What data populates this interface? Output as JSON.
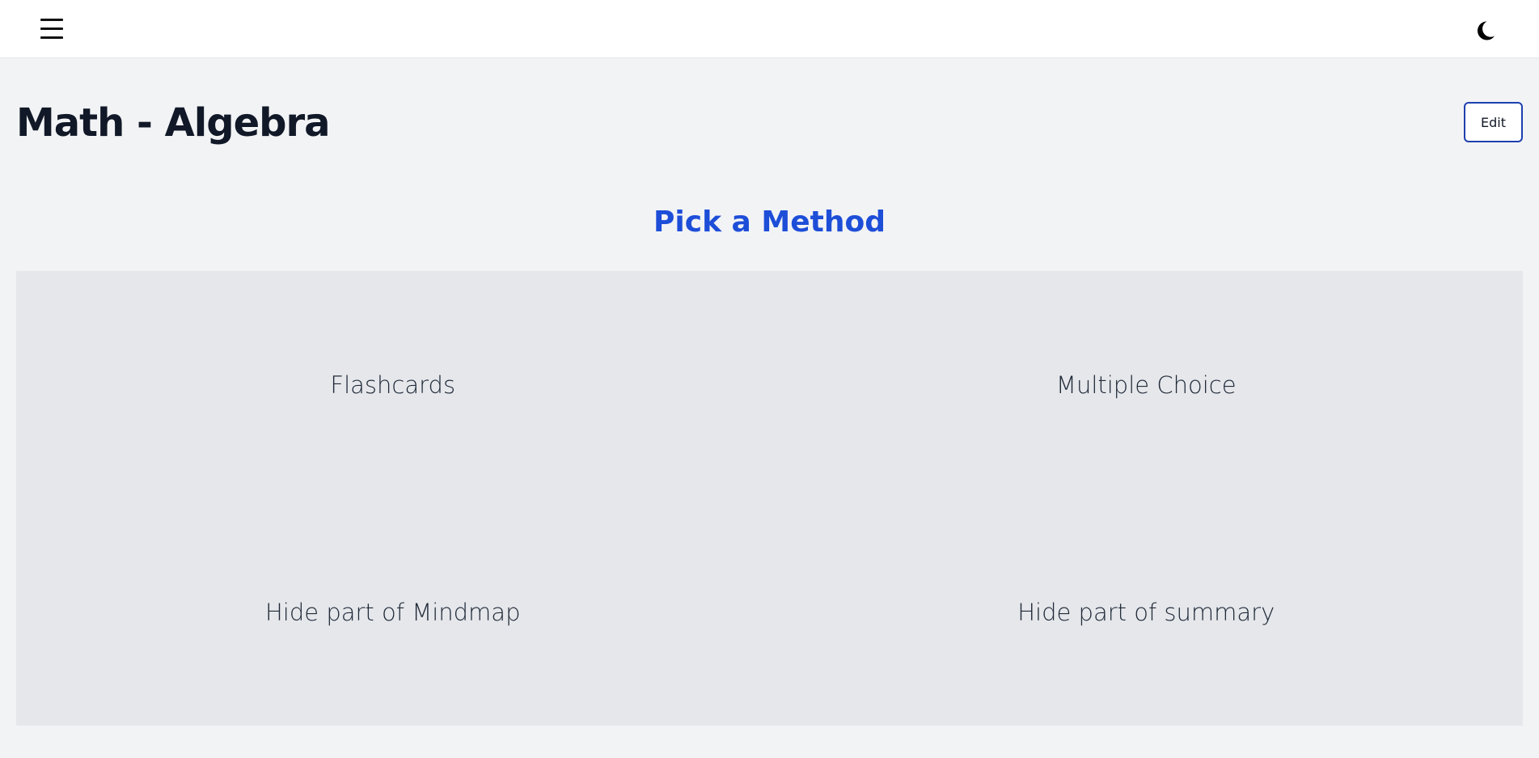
{
  "header": {
    "menu_icon": "hamburger-menu-icon",
    "theme_icon": "moon-icon"
  },
  "page": {
    "title": "Math - Algebra",
    "edit_label": "Edit"
  },
  "methods": {
    "title": "Pick a Method",
    "items": [
      {
        "label": "Flashcards"
      },
      {
        "label": "Multiple Choice"
      },
      {
        "label": "Hide part of Mindmap"
      },
      {
        "label": "Hide part of summary"
      }
    ]
  },
  "colors": {
    "accent": "#1d4ed8",
    "edit_border": "#1e40af",
    "page_background": "#f2f3f5",
    "grid_background": "#e5e7eb",
    "header_background": "#ffffff"
  }
}
